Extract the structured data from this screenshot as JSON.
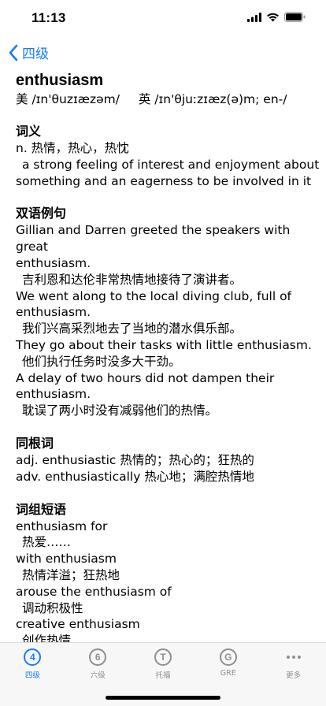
{
  "status_bar": {
    "time": "11:13"
  },
  "nav": {
    "back_label": "四级"
  },
  "entry": {
    "word": "enthusiasm",
    "phonetic_us_label": "美",
    "phonetic_us": "/ɪn'θuzɪæzəm/",
    "phonetic_uk_label": "英",
    "phonetic_uk": "/ɪn'θjuːzɪæz(ə)m; en-/"
  },
  "definition": {
    "title": "词义",
    "lines": [
      "n. 热情，热心，热忱",
      "  a strong feeling of interest and enjoyment about",
      "something and an eagerness to be involved in it"
    ]
  },
  "examples": {
    "title": "双语例句",
    "lines": [
      "Gillian and Darren greeted the speakers with great",
      "enthusiasm.",
      "  吉利恩和达伦非常热情地接待了演讲者。",
      "We went along to the local diving club, full of",
      "enthusiasm.",
      "  我们兴高采烈地去了当地的潜水俱乐部。",
      "They go about their tasks with little enthusiasm.",
      "  他们执行任务时没多大干劲。",
      "A delay of two hours did not dampen their",
      "enthusiasm.",
      "  耽误了两小时没有减弱他们的热情。"
    ]
  },
  "cognates": {
    "title": "同根词",
    "lines": [
      "adj.  enthusiastic 热情的；热心的；狂热的",
      "adv.  enthusiastically 热心地；满腔热情地"
    ]
  },
  "phrases": {
    "title": "词组短语",
    "lines": [
      "enthusiasm for",
      "  热爱……",
      "with enthusiasm",
      "  热情洋溢；狂热地",
      "arouse the enthusiasm of",
      "  调动积极性",
      "creative enthusiasm",
      "  创作热情"
    ]
  },
  "tabs": [
    {
      "icon": "4",
      "label": "四级"
    },
    {
      "icon": "6",
      "label": "六级"
    },
    {
      "icon": "T",
      "label": "托福"
    },
    {
      "icon": "G",
      "label": "GRE"
    },
    {
      "icon": "",
      "label": "更多"
    }
  ],
  "colors": {
    "accent": "#1a7cf5",
    "inactive": "#8e8e93"
  }
}
